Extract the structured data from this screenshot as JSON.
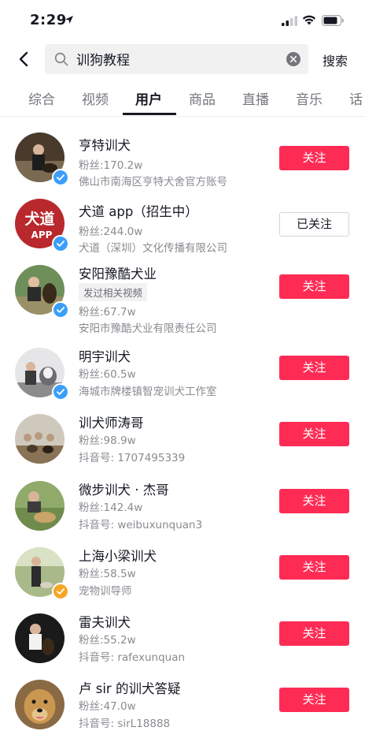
{
  "status_bar": {
    "time": "2:29"
  },
  "search": {
    "query": "训狗教程",
    "button_label": "搜索"
  },
  "tabs": [
    {
      "label": "综合"
    },
    {
      "label": "视频"
    },
    {
      "label": "用户"
    },
    {
      "label": "商品"
    },
    {
      "label": "直播"
    },
    {
      "label": "音乐"
    },
    {
      "label": "话"
    }
  ],
  "active_tab": "用户",
  "users": [
    {
      "name": "亨特训犬",
      "fans": "粉丝:170.2w",
      "info": "佛山市南海区亨特犬舍官方账号",
      "follow_label": "关注",
      "followed": false,
      "verified_color": "#3a9efb"
    },
    {
      "name": "犬道 app（招生中）",
      "fans": "粉丝:244.0w",
      "info": "犬道（深圳）文化传播有限公司",
      "follow_label": "已关注",
      "followed": true,
      "verified_color": "#3a9efb",
      "avatar_text": "犬道",
      "avatar_sub": "APP"
    },
    {
      "name": "安阳豫酷犬业",
      "tag": "发过相关视频",
      "fans": "粉丝:67.7w",
      "info": "安阳市豫酷犬业有限责任公司",
      "follow_label": "关注",
      "followed": false,
      "verified_color": "#3a9efb"
    },
    {
      "name": "明宇训犬",
      "fans": "粉丝:60.5w",
      "info": "海城市牌楼镇智宠训犬工作室",
      "follow_label": "关注",
      "followed": false,
      "verified_color": "#3a9efb"
    },
    {
      "name": "训犬师涛哥",
      "fans": "粉丝:98.9w",
      "info": "抖音号: 1707495339",
      "follow_label": "关注",
      "followed": false
    },
    {
      "name": "微步训犬 · 杰哥",
      "fans": "粉丝:142.4w",
      "info": "抖音号: weibuxunquan3",
      "follow_label": "关注",
      "followed": false
    },
    {
      "name": "上海小梁训犬",
      "fans": "粉丝:58.5w",
      "info": "宠物训导师",
      "follow_label": "关注",
      "followed": false,
      "verified_color": "#f5a623"
    },
    {
      "name": "雷夫训犬",
      "fans": "粉丝:55.2w",
      "info": "抖音号: rafexunquan",
      "follow_label": "关注",
      "followed": false
    },
    {
      "name": "卢 sir 的训犬答疑",
      "fans": "粉丝:47.0w",
      "info": "抖音号: sirL18888",
      "follow_label": "关注",
      "followed": false
    }
  ]
}
